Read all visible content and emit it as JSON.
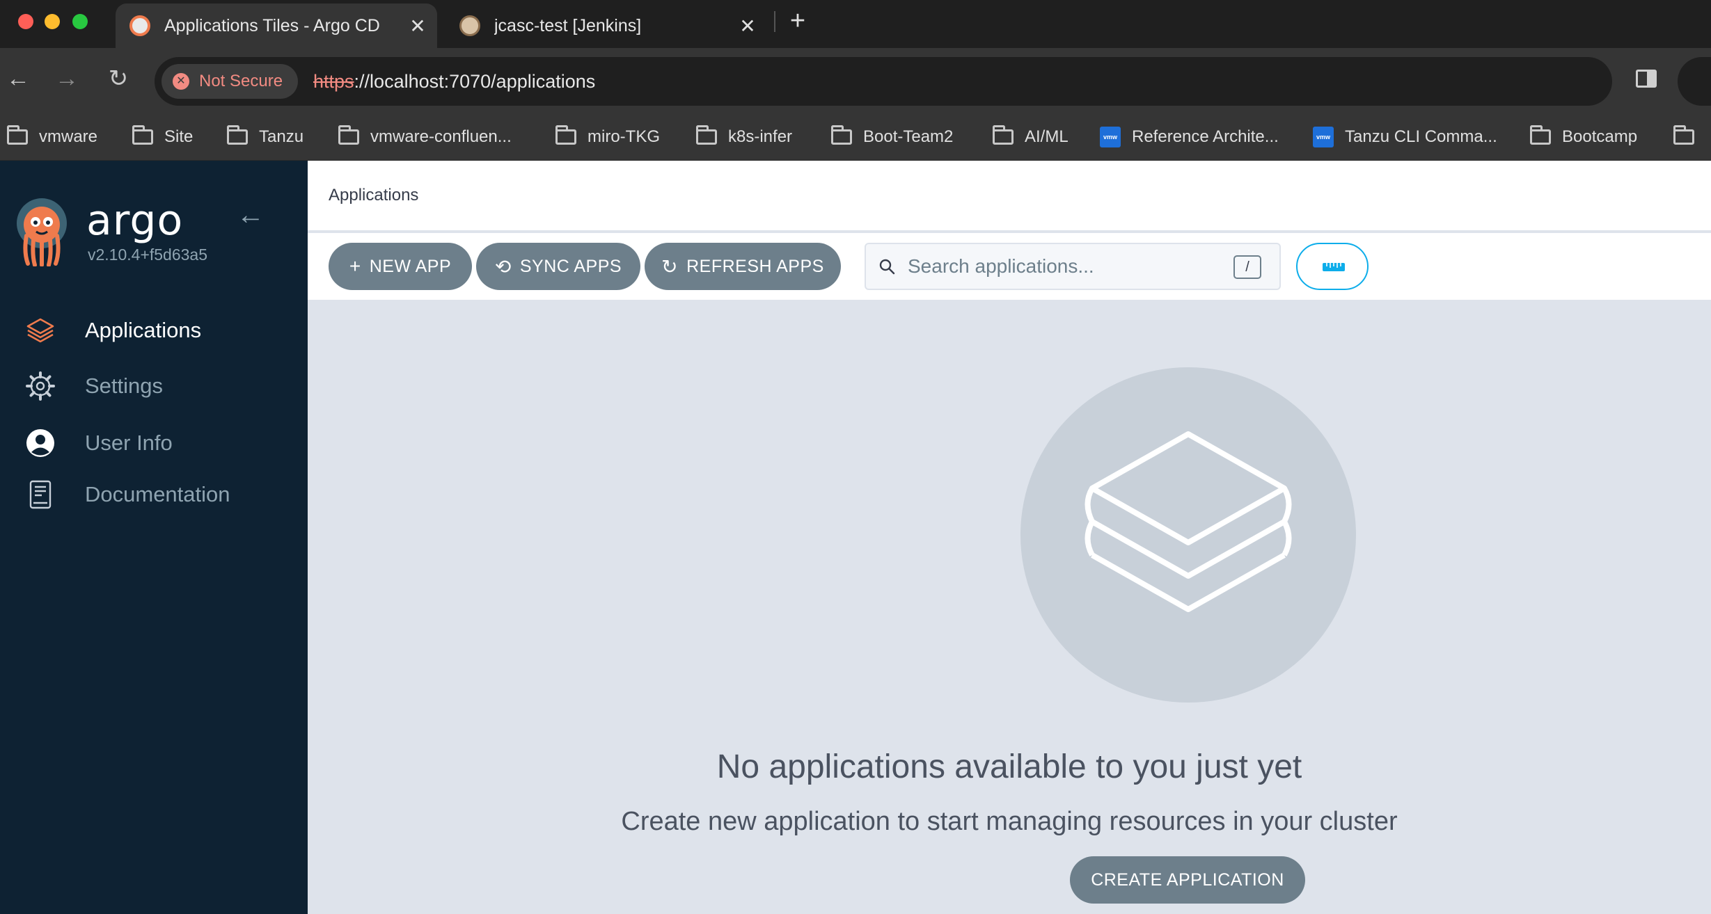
{
  "browser": {
    "tabs": [
      {
        "title": "Applications Tiles - Argo CD",
        "active": true
      },
      {
        "title": "jcasc-test [Jenkins]",
        "active": false
      }
    ],
    "new_tab_glyph": "+",
    "close_glyph": "✕",
    "address": {
      "security_label": "Not Secure",
      "url_scheme": "https",
      "url_rest": "://localhost:7070/applications"
    },
    "bookmarks": [
      {
        "label": "vmware",
        "icon": "folder-icon"
      },
      {
        "label": "Site",
        "icon": "folder-icon"
      },
      {
        "label": "Tanzu",
        "icon": "folder-icon"
      },
      {
        "label": "vmware-confluen...",
        "icon": "folder-icon"
      },
      {
        "label": "miro-TKG",
        "icon": "folder-icon"
      },
      {
        "label": "k8s-infer",
        "icon": "folder-icon"
      },
      {
        "label": "Boot-Team2",
        "icon": "folder-icon"
      },
      {
        "label": "AI/ML",
        "icon": "folder-icon"
      },
      {
        "label": "Reference Archite...",
        "icon": "vmware-favicon"
      },
      {
        "label": "Tanzu CLI Comma...",
        "icon": "vmware-favicon"
      },
      {
        "label": "Bootcamp",
        "icon": "folder-icon"
      }
    ]
  },
  "sidebar": {
    "brand": "argo",
    "version": "v2.10.4+f5d63a5",
    "nav": [
      {
        "label": "Applications",
        "icon": "layers-icon",
        "active": true
      },
      {
        "label": "Settings",
        "icon": "gear-icon",
        "active": false
      },
      {
        "label": "User Info",
        "icon": "user-icon",
        "active": false
      },
      {
        "label": "Documentation",
        "icon": "book-icon",
        "active": false
      }
    ]
  },
  "main": {
    "breadcrumb": "Applications",
    "actions": {
      "new_app": "NEW APP",
      "sync_apps": "SYNC APPS",
      "refresh_apps": "REFRESH APPS"
    },
    "search": {
      "placeholder": "Search applications...",
      "shortcut": "/"
    },
    "empty_state": {
      "title": "No applications available to you just yet",
      "subtitle": "Create new application to start managing resources in your cluster",
      "button": "CREATE APPLICATION"
    }
  },
  "colors": {
    "sidebar_bg": "#0e2233",
    "accent_orange": "#ef7b4d",
    "button_gray": "#6d7f8b",
    "main_bg": "#dee3eb",
    "accent_teal": "#0dadea"
  }
}
